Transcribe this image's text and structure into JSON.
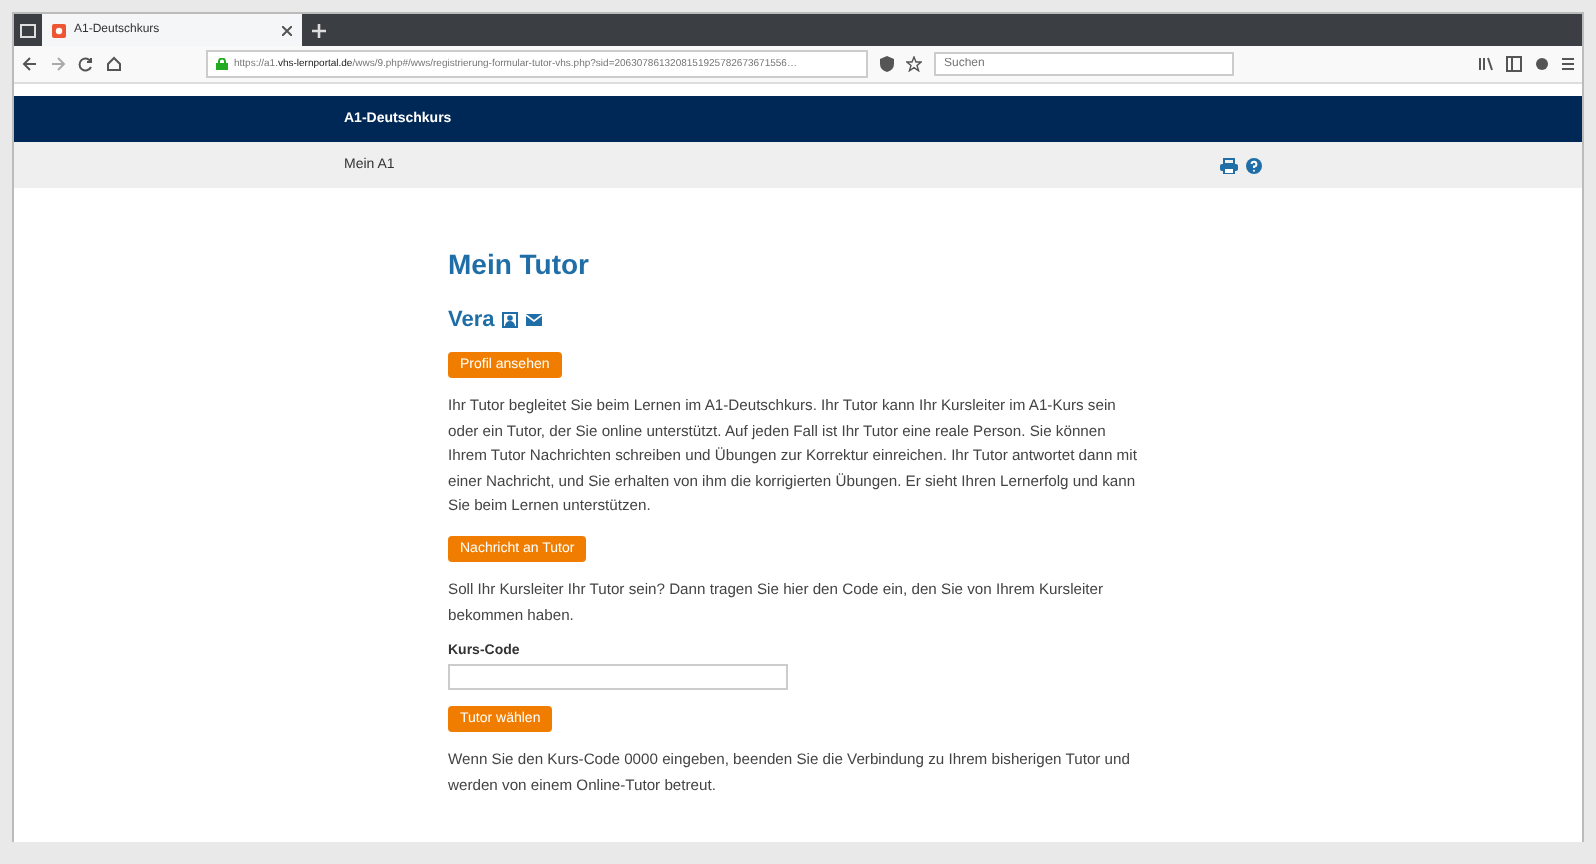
{
  "browser": {
    "tab_title": "A1-Deutschkurs",
    "url_host": "https://a1.",
    "url_domain": "vhs-lernportal.de",
    "url_path": "/wws/9.php#/wws/registrierung-formular-tutor-vhs.php?sid=2063078613208151925782673671556…",
    "search": {
      "placeholder": "Suchen"
    }
  },
  "site": {
    "title": "A1-Deutschkurs",
    "breadcrumb": "Mein A1"
  },
  "content": {
    "heading": "Mein Tutor",
    "tutor_name": "Vera",
    "buttons": [
      "Profil ansehen",
      "Nachricht an Tutor",
      "Tutor wählen"
    ],
    "intro": "Ihr Tutor begleitet Sie beim Lernen im A1-Deutschkurs. Ihr Tutor kann Ihr Kursleiter im A1-Kurs sein oder ein Tutor, der Sie online unterstützt. Auf jeden Fall ist Ihr Tutor eine reale Person. Sie können Ihrem Tutor Nachrichten schreiben und Übungen zur Korrektur einreichen. Ihr Tutor antwortet dann mit einer Nachricht, und Sie erhalten von ihm die korrigierten Übungen. Er sieht Ihren Lernerfolg und kann Sie beim Lernen unterstützen.",
    "code_hint": "Soll Ihr Kursleiter Ihr Tutor sein? Dann tragen Sie hier den Code ein, den Sie von Ihrem Kursleiter bekommen haben.",
    "code_label": "Kurs-Code",
    "footer_note": "Wenn Sie den Kurs-Code 0000 eingeben, beenden Sie die Verbindung zu Ihrem bisherigen Tutor und werden von einem Online-Tutor betreut."
  }
}
